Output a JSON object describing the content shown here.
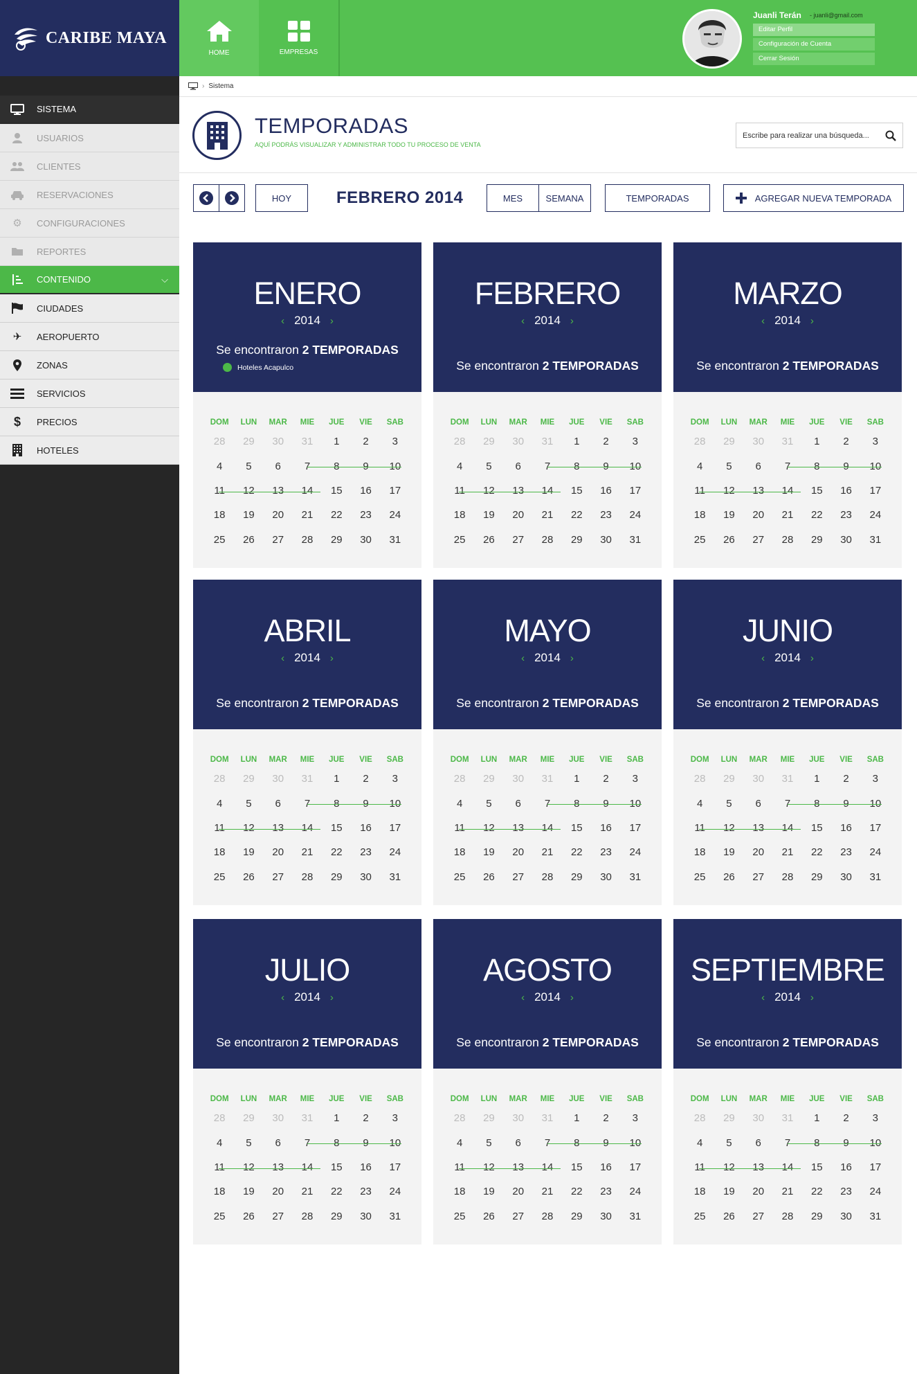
{
  "brand": {
    "name": "CARIBE MAYA"
  },
  "sidebar": {
    "items": [
      {
        "label": "SISTEMA",
        "icon": "monitor-icon"
      },
      {
        "label": "USUARIOS",
        "icon": "user-icon"
      },
      {
        "label": "CLIENTES",
        "icon": "users-icon"
      },
      {
        "label": "RESERVACIONES",
        "icon": "taxi-icon"
      },
      {
        "label": "CONFIGURACIONES",
        "icon": "gear-icon"
      },
      {
        "label": "REPORTES",
        "icon": "folder-icon"
      },
      {
        "label": "CONTENIDO",
        "icon": "sort-list-icon"
      },
      {
        "label": "CIUDADES",
        "icon": "flag-icon"
      },
      {
        "label": "AEROPUERTO",
        "icon": "plane-icon"
      },
      {
        "label": "ZONAS",
        "icon": "map-pin-icon"
      },
      {
        "label": "SERVICIOS",
        "icon": "bars-icon"
      },
      {
        "label": "PRECIOS",
        "icon": "dollar-icon"
      },
      {
        "label": "HOTELES",
        "icon": "building-icon"
      }
    ]
  },
  "topnav": {
    "home": "HOME",
    "empresas": "EMPRESAS"
  },
  "user": {
    "name": "Juanli Terán",
    "email": "- juanli@gmail.com",
    "menu": [
      "Editar Perfil",
      "Configuración de Cuenta",
      "Cerrar Sesión"
    ]
  },
  "breadcrumb": {
    "current": "Sistema"
  },
  "header": {
    "title": "TEMPORADAS",
    "subtitle": "AQUÍ PODRÁS VISUALIZAR Y ADMINISTRAR TODO TU PROCESO DE VENTA",
    "search_placeholder": "Escribe para realizar una búsqueda..."
  },
  "toolbar": {
    "today": "HOY",
    "period": "FEBRERO 2014",
    "month": "MES",
    "week": "SEMANA",
    "seasons": "TEMPORADAS",
    "add": "AGREGAR NUEVA TEMPORADA"
  },
  "calendar": {
    "dow": [
      "DOM",
      "LUN",
      "MAR",
      "MIE",
      "JUE",
      "VIE",
      "SAB"
    ],
    "found_prefix": "Se encontraron",
    "found_count": "2 TEMPORADAS",
    "legend": "Hoteles Acapulco",
    "weeks": [
      [
        "28",
        "29",
        "30",
        "31",
        "1",
        "2",
        "3"
      ],
      [
        "4",
        "5",
        "6",
        "7",
        "8",
        "9",
        "10"
      ],
      [
        "11",
        "12",
        "13",
        "14",
        "15",
        "16",
        "17"
      ],
      [
        "18",
        "19",
        "20",
        "21",
        "22",
        "23",
        "24"
      ],
      [
        "25",
        "26",
        "27",
        "28",
        "29",
        "30",
        "31"
      ]
    ],
    "months": [
      {
        "name": "ENERO",
        "year": "2014"
      },
      {
        "name": "FEBRERO",
        "year": "2014"
      },
      {
        "name": "MARZO",
        "year": "2014"
      },
      {
        "name": "ABRIL",
        "year": "2014"
      },
      {
        "name": "MAYO",
        "year": "2014"
      },
      {
        "name": "JUNIO",
        "year": "2014"
      },
      {
        "name": "JULIO",
        "year": "2014"
      },
      {
        "name": "AGOSTO",
        "year": "2014"
      },
      {
        "name": "SEPTIEMBRE",
        "year": "2014"
      }
    ]
  },
  "colors": {
    "navy": "#232d5f",
    "green": "#4cb848",
    "sidebar": "#262626"
  }
}
